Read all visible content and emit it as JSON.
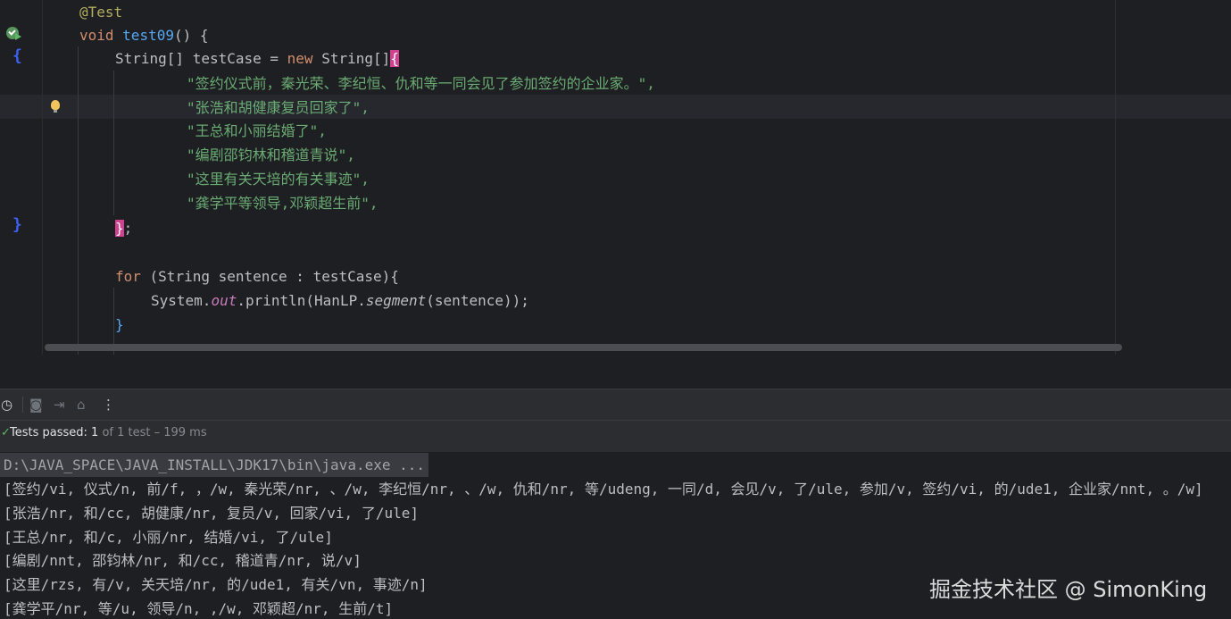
{
  "editor": {
    "annotation": "@Test",
    "method_kw": "void",
    "method_name": "test09",
    "method_rest": "() {",
    "decl_type": "String[] testCase = ",
    "decl_new": "new",
    "decl_type2": " String[]",
    "decl_open": "{",
    "strings": [
      "\"签约仪式前，秦光荣、李纪恒、仇和等一同会见了参加签约的企业家。\",",
      "\"张浩和胡健康复员回家了\",",
      "\"王总和小丽结婚了\",",
      "\"编剧邵钧林和稽道青说\",",
      "\"这里有关天培的有关事迹\",",
      "\"龚学平等领导,邓颖超生前\","
    ],
    "decl_close": "}",
    "decl_semicolon": ";",
    "for_kw": "for",
    "for_rest": " (String sentence : testCase){",
    "print_prefix": "System.",
    "print_field": "out",
    "print_mid": ".println(HanLP.",
    "print_method": "segment",
    "print_suffix": "(sentence));",
    "loop_close": "}",
    "gutter_open": "{",
    "gutter_close": "}"
  },
  "status": {
    "passed": "Tests passed: 1",
    "detail": " of 1 test – 199 ms"
  },
  "console": {
    "command": "D:\\JAVA_SPACE\\JAVA_INSTALL\\JDK17\\bin\\java.exe ...",
    "lines": [
      "[签约/vi, 仪式/n, 前/f, ，/w, 秦光荣/nr, 、/w, 李纪恒/nr, 、/w, 仇和/nr, 等/udeng, 一同/d, 会见/v, 了/ule, 参加/v, 签约/vi, 的/ude1, 企业家/nnt, 。/w]",
      "[张浩/nr, 和/cc, 胡健康/nr, 复员/v, 回家/vi, 了/ule]",
      "[王总/nr, 和/c, 小丽/nr, 结婚/vi, 了/ule]",
      "[编剧/nnt, 邵钧林/nr, 和/cc, 稽道青/nr, 说/v]",
      "[这里/rzs, 有/v, 关天培/nr, 的/ude1, 有关/vn, 事迹/n]",
      "[龚学平/nr, 等/u, 领导/n, ,/w, 邓颖超/nr, 生前/t]"
    ]
  },
  "watermark": "掘金技术社区 @ SimonKing",
  "icons": [
    "run-test-icon",
    "lightbulb-icon",
    "history-icon",
    "camera-icon",
    "import-icon",
    "export-icon",
    "more-icon",
    "check-icon"
  ]
}
